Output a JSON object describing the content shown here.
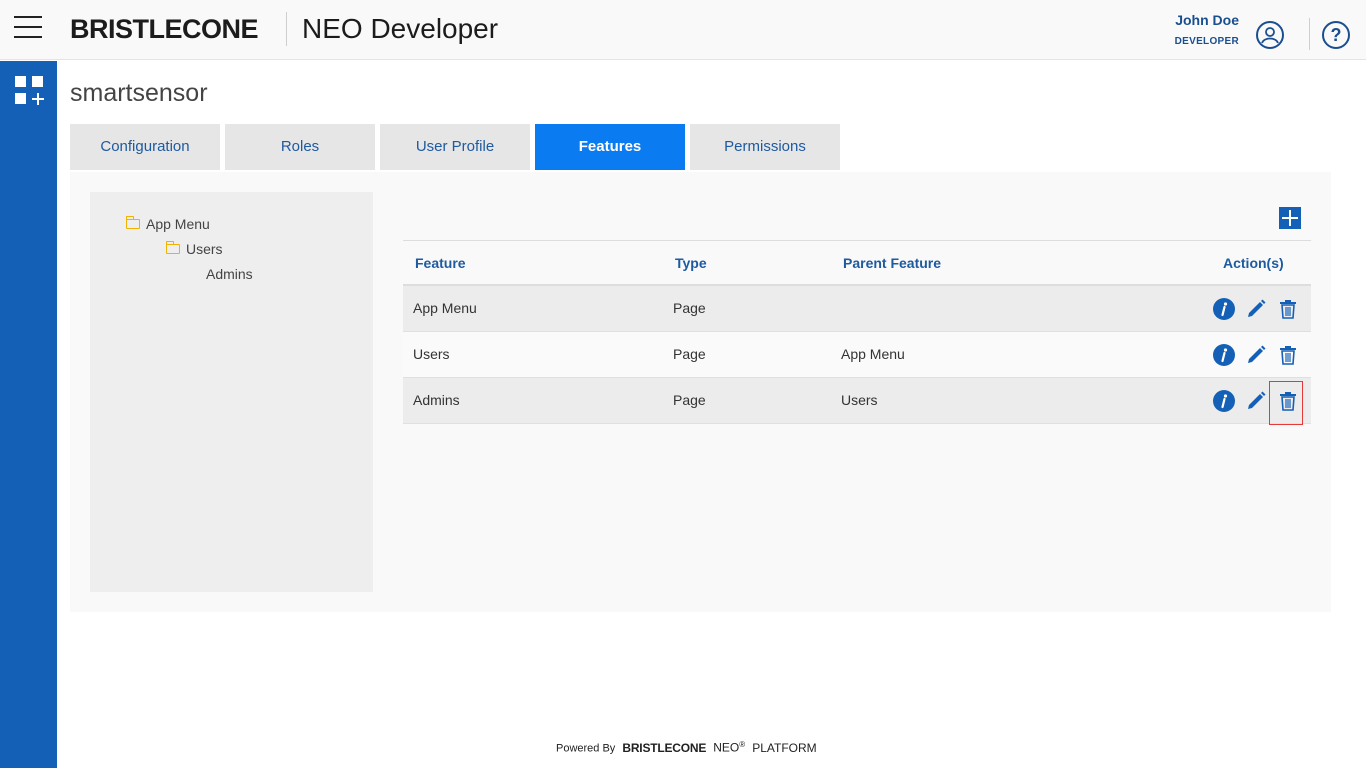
{
  "header": {
    "brand": "BRISTLECONE",
    "app_title": "NEO Developer",
    "user_name": "John Doe",
    "user_role": "DEVELOPER",
    "help_glyph": "?"
  },
  "page": {
    "title": "smartsensor"
  },
  "tabs": [
    {
      "label": "Configuration",
      "active": false
    },
    {
      "label": "Roles",
      "active": false
    },
    {
      "label": "User Profile",
      "active": false
    },
    {
      "label": "Features",
      "active": true
    },
    {
      "label": "Permissions",
      "active": false
    }
  ],
  "tree": [
    {
      "label": "App Menu",
      "level": 0,
      "folder": true
    },
    {
      "label": "Users",
      "level": 1,
      "folder": true
    },
    {
      "label": "Admins",
      "level": 2,
      "folder": false
    }
  ],
  "table": {
    "headers": {
      "feature": "Feature",
      "type": "Type",
      "parent": "Parent Feature",
      "actions": "Action(s)"
    },
    "rows": [
      {
        "feature": "App Menu",
        "type": "Page",
        "parent": ""
      },
      {
        "feature": "Users",
        "type": "Page",
        "parent": "App Menu"
      },
      {
        "feature": "Admins",
        "type": "Page",
        "parent": "Users"
      }
    ]
  },
  "footer": {
    "powered_by": "Powered By",
    "brand": "BRISTLECONE",
    "neo": "NEO",
    "reg": "®",
    "platform": "PLATFORM"
  },
  "colors": {
    "primary": "#1560b7",
    "active_tab": "#0a7bf0",
    "accent_text": "#1e5aa0",
    "folder": "#f0b400",
    "highlight": "#e53935"
  },
  "icons": {
    "menu": "hamburger-menu-icon",
    "apps": "apps-grid-icon",
    "user": "user-avatar-icon",
    "help": "help-icon",
    "add": "add-plus-icon",
    "info": "info-icon",
    "edit": "edit-pencil-icon",
    "delete": "trash-icon",
    "folder": "folder-open-icon"
  }
}
